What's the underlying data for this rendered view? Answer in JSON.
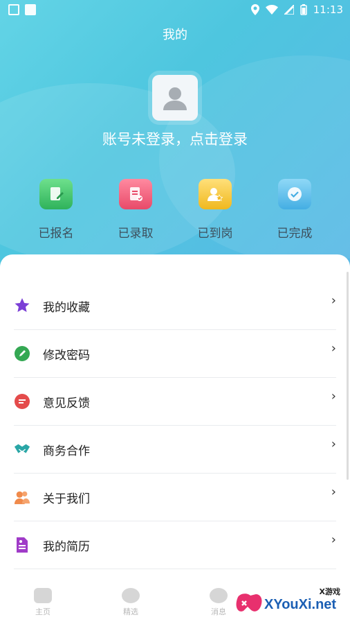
{
  "status": {
    "time": "11:13"
  },
  "header": {
    "title": "我的"
  },
  "profile": {
    "login_text": "账号未登录，点击登录"
  },
  "stats": [
    {
      "label": "已报名",
      "icon": "signup-doc-icon",
      "color": "#45c26b"
    },
    {
      "label": "已录取",
      "icon": "admitted-doc-icon",
      "color": "#ee5e78"
    },
    {
      "label": "已到岗",
      "icon": "user-star-icon",
      "color": "#f2c230"
    },
    {
      "label": "已完成",
      "icon": "check-circle-icon",
      "color": "#5bbde9"
    }
  ],
  "menu": [
    {
      "label": "我的收藏",
      "icon": "star-icon"
    },
    {
      "label": "修改密码",
      "icon": "pencil-icon"
    },
    {
      "label": "意见反馈",
      "icon": "feedback-icon"
    },
    {
      "label": "商务合作",
      "icon": "handshake-icon"
    },
    {
      "label": "关于我们",
      "icon": "people-icon"
    },
    {
      "label": "我的简历",
      "icon": "resume-icon"
    }
  ],
  "tabs": [
    {
      "label": "主页",
      "icon": "home-icon"
    },
    {
      "label": "精选",
      "icon": "featured-icon"
    },
    {
      "label": "消息",
      "icon": "message-icon"
    }
  ],
  "watermark": {
    "small": "X游戏",
    "main": "XYouXi.net"
  }
}
